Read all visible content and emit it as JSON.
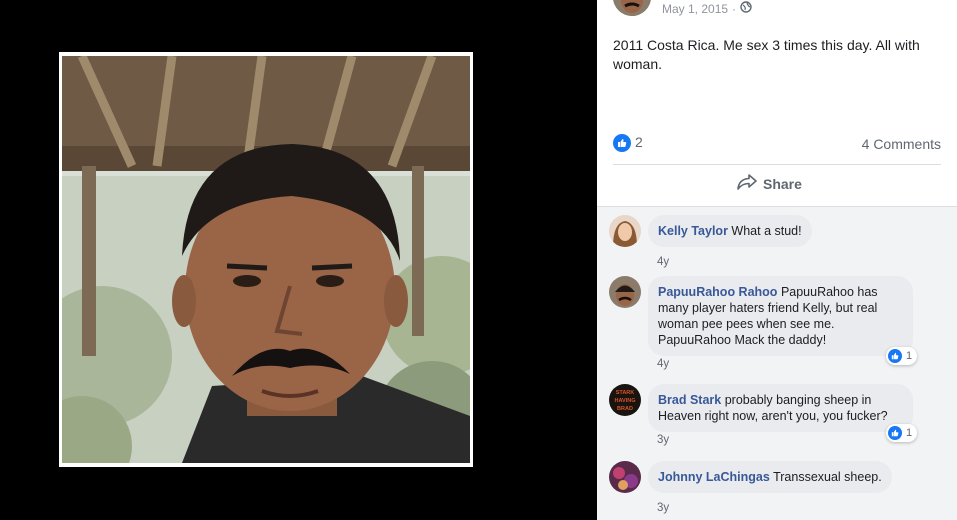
{
  "post": {
    "date": "May 1, 2015",
    "separator": "·",
    "privacy_icon": "globe-icon",
    "text": "2011 Costa Rica. Me sex 3 times this day. All with woman.",
    "likes": "2",
    "comments_count": "4 Comments",
    "share_label": "Share"
  },
  "comments": [
    {
      "name": "Kelly Taylor",
      "text": "What a stud!",
      "time": "4y",
      "reactions": ""
    },
    {
      "name": "PapuuRahoo Rahoo",
      "text": "PapuuRahoo has many player haters friend Kelly, but real woman pee pees when see me. PapuuRahoo Mack the daddy!",
      "time": "4y",
      "reactions": "1"
    },
    {
      "name": "Brad Stark",
      "text": "probably banging sheep in Heaven right now, aren't you, you fucker?",
      "time": "3y",
      "reactions": "1"
    },
    {
      "name": "Johnny LaChingas",
      "text": "Transsexual sheep.",
      "time": "3y",
      "reactions": ""
    }
  ],
  "avatar_badge_text": "STARK HAVING BRAD",
  "colors": {
    "link": "#385898",
    "accent": "#1877f2",
    "muted": "#606770"
  }
}
